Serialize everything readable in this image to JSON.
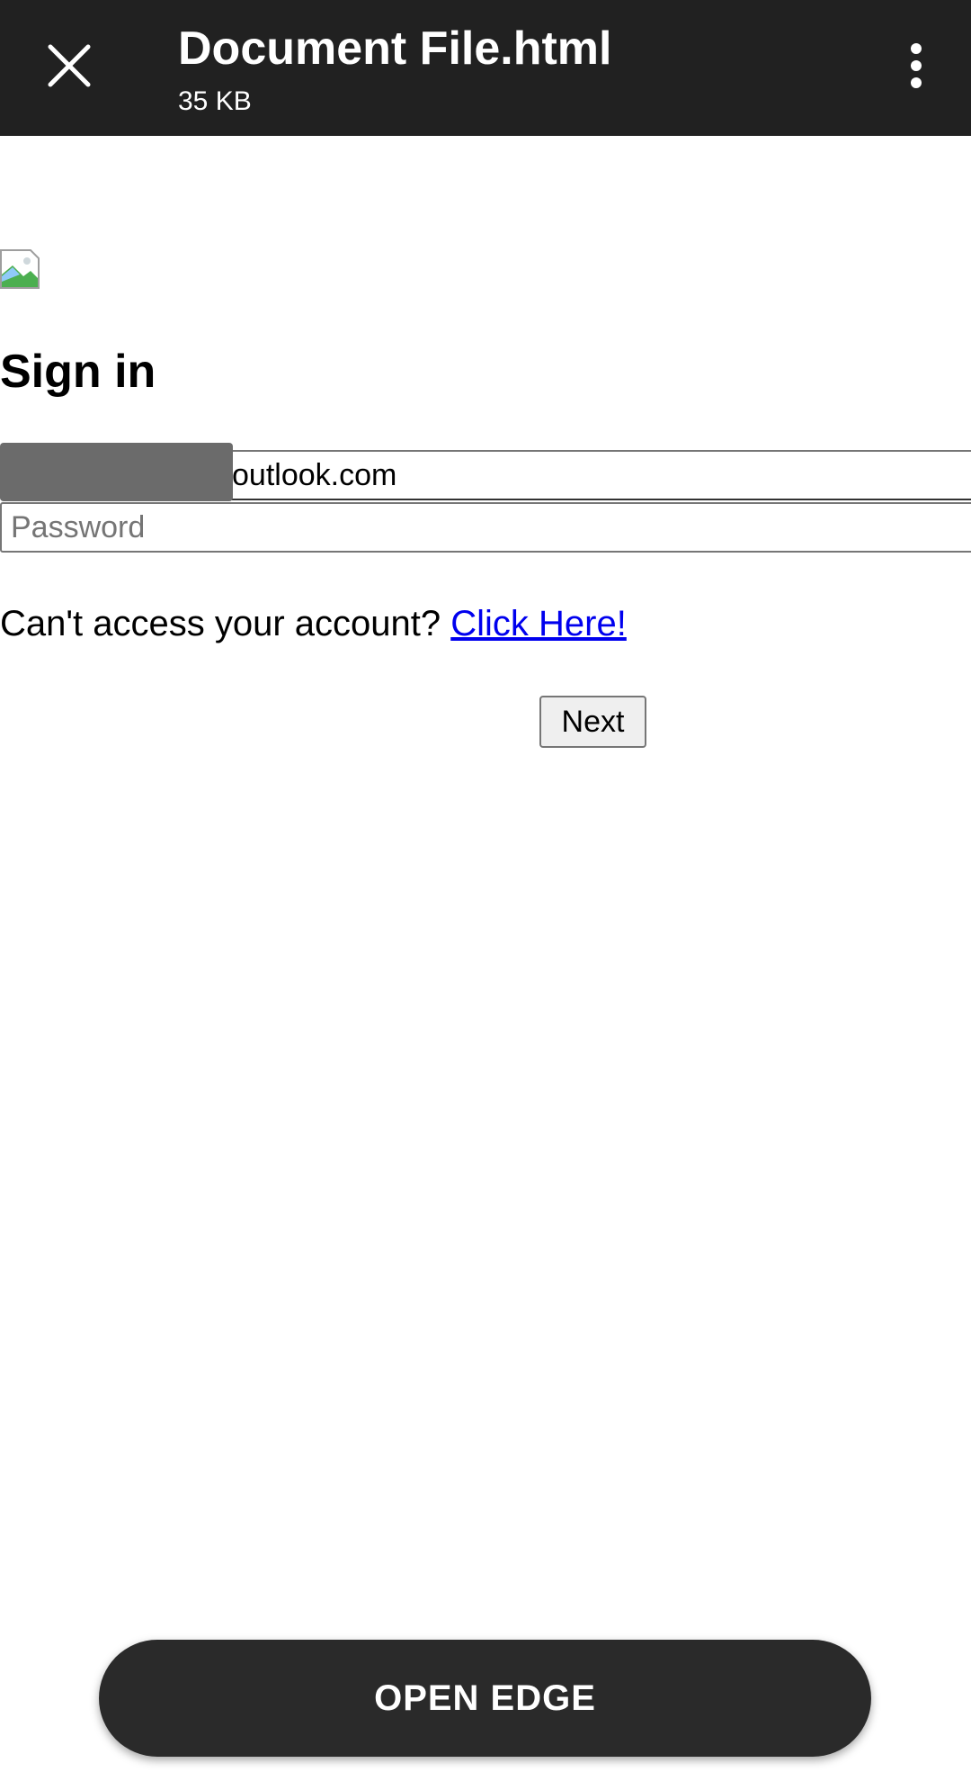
{
  "header": {
    "title": "Document File.html",
    "file_size": "35 KB",
    "close_icon": "close-icon",
    "more_icon": "more-vertical-icon"
  },
  "page": {
    "image_icon": "broken-image-icon",
    "heading": "Sign in",
    "email": {
      "value": "outlook.com",
      "redacted": true
    },
    "password": {
      "value": "",
      "placeholder": "Password"
    },
    "access_text": "Can't access your account?",
    "access_link": "Click Here!",
    "next_label": "Next"
  },
  "footer": {
    "open_edge_label": "OPEN EDGE"
  },
  "colors": {
    "topbar": "#212121",
    "link": "#0000ee",
    "button_dark": "#2a2a2a"
  }
}
